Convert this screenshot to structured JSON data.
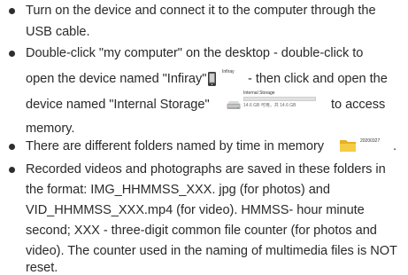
{
  "instructions": [
    {
      "lines": [
        "Turn on the device and connect it to the computer through the",
        "USB cable."
      ]
    },
    {
      "lines": [
        "Double-click \"my computer\" on the desktop - double-click to",
        "open the device named \"Infiray\"",
        "- then click and open the",
        "device named \"Internal Storage\"",
        "to access",
        "memory."
      ],
      "infiray_icon_label": "Infiray",
      "storage_drive": {
        "title": "Internal Storage",
        "usage": "14.6 GB 可用，共 14.6 GB",
        "fill_fraction": 0.0
      }
    },
    {
      "lines": [
        "There are different folders named by time in memory",
        "."
      ],
      "folder_label": "20200327"
    },
    {
      "lines": [
        "Recorded videos and photographs are saved in these folders in",
        "the format: IMG_HHMMSS_XXX. jpg (for photos) and",
        "VID_HHMMSS_XXX.mp4 (for video). HMMSS- hour minute",
        "second; XXX - three-digit common file counter (for photos and",
        "video). The counter used in the naming of multimedia files is NOT",
        "reset."
      ]
    }
  ],
  "colors": {
    "text": "#2a2a2a",
    "folder": "#f4c430",
    "drive_bar": "#e0e0e0"
  },
  "icons": [
    "device-phone-icon",
    "hard-drive-icon",
    "folder-icon"
  ]
}
